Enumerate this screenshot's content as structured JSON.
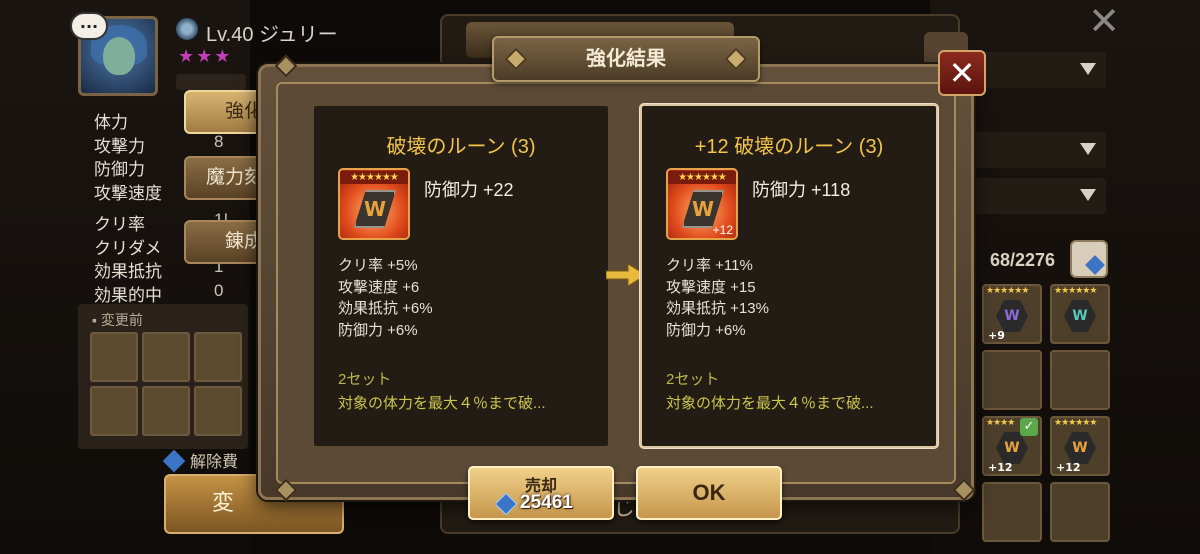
{
  "hero": {
    "name": "Lv.40 ジュリー",
    "stars": "★★★",
    "chat_icon": "...",
    "stats": [
      {
        "label": "体力",
        "value": ""
      },
      {
        "label": "攻撃力",
        "value": "8"
      },
      {
        "label": "防御力",
        "value": ""
      },
      {
        "label": "攻撃速度",
        "value": ""
      },
      {
        "label": "クリ率",
        "value": "1!"
      },
      {
        "label": "クリダメ",
        "value": ""
      },
      {
        "label": "効果抵抗",
        "value": "1"
      },
      {
        "label": "効果的中",
        "value": "0"
      }
    ]
  },
  "side_menu": {
    "enhance": "強化",
    "engrave": "魔力刻印",
    "refine": "錬成"
  },
  "before_change": {
    "label": "変更前",
    "unlock_fee": "解除費",
    "change_button": "変"
  },
  "inventory": {
    "count": "68/2276",
    "items": [
      {
        "stars": "★★★★★★",
        "level": "+9",
        "glyph": "W",
        "color": "#8c6ad8",
        "checked": false
      },
      {
        "stars": "★★★★★★",
        "level": "",
        "glyph": "W",
        "color": "#57c7b8",
        "checked": false
      },
      {
        "stars": "",
        "level": "",
        "glyph": "",
        "color": "",
        "checked": false
      },
      {
        "stars": "",
        "level": "",
        "glyph": "",
        "color": "",
        "checked": false
      },
      {
        "stars": "★★★★",
        "level": "+12",
        "glyph": "W",
        "color": "#e8a23c",
        "checked": true
      },
      {
        "stars": "★★★★★★",
        "level": "+12",
        "glyph": "W",
        "color": "#e8a23c",
        "checked": false
      },
      {
        "stars": "",
        "level": "",
        "glyph": "",
        "color": "",
        "checked": false
      },
      {
        "stars": "",
        "level": "",
        "glyph": "",
        "color": "",
        "checked": false
      }
    ]
  },
  "underlying": {
    "close_label": "閉じる"
  },
  "modal": {
    "title": "強化結果",
    "close_glyph": "✕",
    "before": {
      "title": "破壊のルーン (3)",
      "rune_stars": "★★★★★★",
      "rune_glyph": "W",
      "rune_level": "",
      "main_stat": "防御力 +22",
      "sub_stats": [
        "クリ率 +5%",
        "攻撃速度 +6",
        "効果抵抗 +6%",
        "防御力 +6%"
      ],
      "set_label": "2セット",
      "set_desc": "対象の体力を最大４％まで破..."
    },
    "after": {
      "title": "+12 破壊のルーン (3)",
      "rune_stars": "★★★★★★",
      "rune_glyph": "W",
      "rune_level": "+12",
      "main_stat": "防御力 +118",
      "sub_stats": [
        "クリ率 +11%",
        "攻撃速度 +15",
        "効果抵抗 +13%",
        "防御力 +6%"
      ],
      "set_label": "2セット",
      "set_desc": "対象の体力を最大４％まで破..."
    },
    "sell_button": {
      "label": "売却",
      "price": "25461"
    },
    "ok_button": "OK"
  },
  "colors": {
    "title_gold": "#f2c44b",
    "set_text": "#c9c54e",
    "button_gold": "#e0b46a",
    "close_red": "#8c2a1e"
  },
  "icons": [
    "chat-bubble-icon",
    "water-element-icon",
    "gem-icon",
    "bag-icon",
    "arrow-right-icon",
    "close-icon",
    "dropdown-chevron-icon"
  ]
}
